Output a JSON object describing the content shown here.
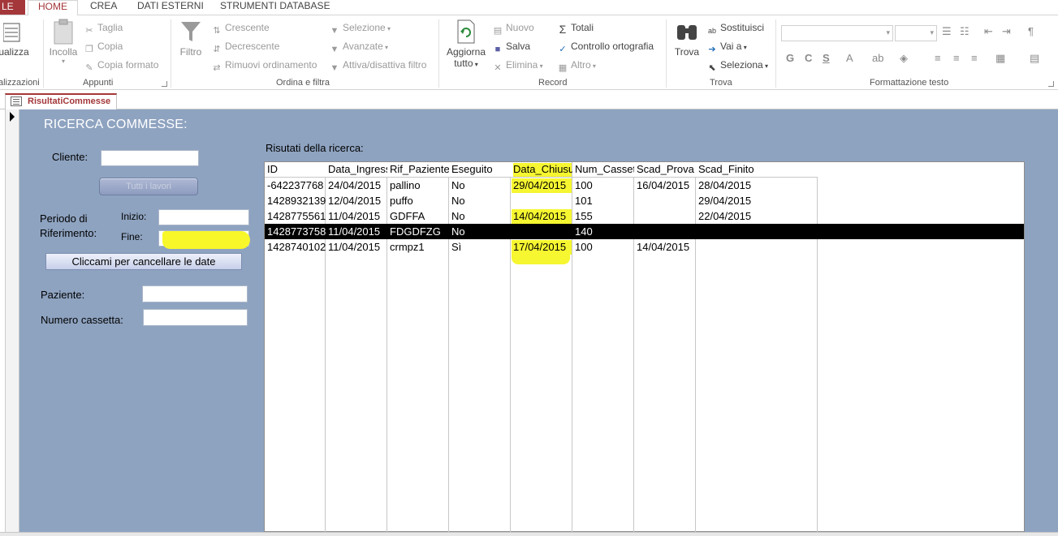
{
  "ribbon": {
    "file_tab": "LE",
    "tabs": [
      "HOME",
      "CREA",
      "DATI ESTERNI",
      "STRUMENTI DATABASE"
    ],
    "views": {
      "button": "ualizza",
      "group": "alizzazioni"
    },
    "clipboard": {
      "paste": "Incolla",
      "cut": "Taglia",
      "copy": "Copia",
      "format_painter": "Copia formato",
      "group": "Appunti"
    },
    "sort_filter": {
      "filter": "Filtro",
      "ascending": "Crescente",
      "descending": "Decrescente",
      "remove_sort": "Rimuovi ordinamento",
      "selection": "Selezione",
      "advanced": "Avanzate",
      "toggle_filter": "Attiva/disattiva filtro",
      "group": "Ordina e filtra"
    },
    "records": {
      "refresh_line1": "Aggiorna",
      "refresh_line2": "tutto",
      "new": "Nuovo",
      "save": "Salva",
      "delete": "Elimina",
      "totals": "Totali",
      "spelling": "Controllo ortografia",
      "more": "Altro",
      "group": "Record"
    },
    "find": {
      "find": "Trova",
      "replace": "Sostituisci",
      "goto": "Vai a",
      "select": "Seleziona",
      "group": "Trova"
    },
    "text_format": {
      "bold": "G",
      "italic": "C",
      "underline": "S",
      "group": "Formattazione testo"
    }
  },
  "doc_tab": "RisultatiCommesse",
  "form": {
    "title": "RICERCA COMMESSE:",
    "cliente_label": "Cliente:",
    "all_jobs_button": "Tutti i lavori",
    "periodo_label_1": "Periodo di",
    "periodo_label_2": "Riferimento:",
    "inizio_label": "Inizio:",
    "fine_label": "Fine:",
    "clear_dates_button": "Cliccami per cancellare le date",
    "paziente_label": "Paziente:",
    "cassetta_label": "Numero cassetta:",
    "results_label": "Risutati della ricerca:"
  },
  "grid": {
    "columns": [
      "ID",
      "Data_Ingresso",
      "Rif_Paziente",
      "Eseguito",
      "Data_Chiusura",
      "Num_Cassetta",
      "Scad_Prova",
      "Scad_Finito"
    ],
    "rows": [
      [
        "-642237768",
        "24/04/2015",
        "pallino",
        "No",
        "29/04/2015",
        "100",
        "16/04/2015",
        "28/04/2015"
      ],
      [
        "1428932139",
        "12/04/2015",
        "puffo",
        "No",
        "",
        "101",
        "",
        "29/04/2015"
      ],
      [
        "1428775561",
        "11/04/2015",
        "GDFFA",
        "No",
        "14/04/2015",
        "155",
        "",
        "22/04/2015"
      ],
      [
        "1428773758",
        "11/04/2015",
        "FDGDFZG",
        "No",
        "",
        "140",
        "",
        ""
      ],
      [
        "1428740102",
        "11/04/2015",
        "crmpz1",
        "Sì",
        "17/04/2015",
        "100",
        "14/04/2015",
        ""
      ]
    ],
    "selected_row": 3,
    "highlight_color": "#f6f631"
  },
  "colors": {
    "accent": "#a4373a",
    "form_bg": "#8ea3c0"
  }
}
